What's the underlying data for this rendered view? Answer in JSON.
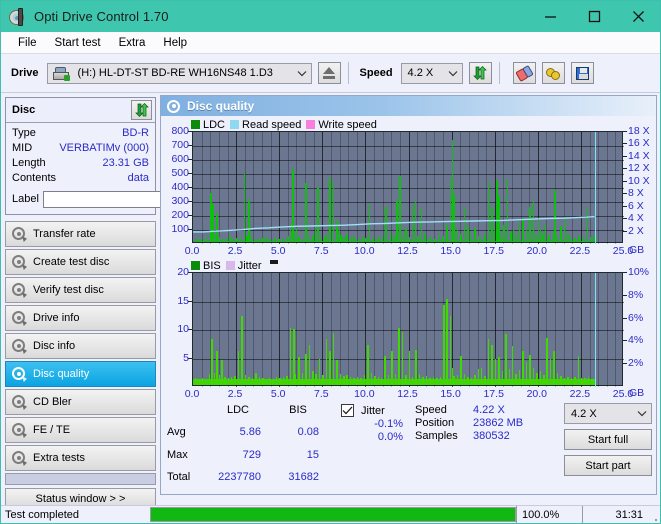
{
  "window": {
    "title": "Opti Drive Control 1.70",
    "icon": "disc-case-icon",
    "minimize": "—",
    "maximize": "□",
    "close": "✕",
    "titlebar_color": "#3ec7ae"
  },
  "menu": {
    "items": [
      {
        "label": "File"
      },
      {
        "label": "Start test"
      },
      {
        "label": "Extra"
      },
      {
        "label": "Help"
      }
    ]
  },
  "toolbar": {
    "drive_label": "Drive",
    "drive_value": "(H:)  HL-DT-ST BD-RE  WH16NS48 1.D3",
    "eject_title": "eject",
    "speed_label": "Speed",
    "speed_value": "4.2 X",
    "refresh_title": "refresh",
    "eraser_title": "erase",
    "gears_title": "settings",
    "save_title": "save"
  },
  "disc": {
    "title": "Disc",
    "refresh_title": "refresh-disc",
    "rows": [
      {
        "key": "Type",
        "value": "BD-R"
      },
      {
        "key": "MID",
        "value": "VERBATIMv (000)"
      },
      {
        "key": "Length",
        "value": "23.31 GB"
      },
      {
        "key": "Contents",
        "value": "data"
      }
    ],
    "label_key": "Label",
    "label_value": "",
    "label_placeholder": ""
  },
  "sidebar": {
    "items": [
      {
        "label": "Transfer rate",
        "active": false
      },
      {
        "label": "Create test disc",
        "active": false
      },
      {
        "label": "Verify test disc",
        "active": false
      },
      {
        "label": "Drive info",
        "active": false
      },
      {
        "label": "Disc info",
        "active": false
      },
      {
        "label": "Disc quality",
        "active": true
      },
      {
        "label": "CD Bler",
        "active": false
      },
      {
        "label": "FE / TE",
        "active": false
      },
      {
        "label": "Extra tests",
        "active": false
      }
    ],
    "status_window_button": "Status window > >"
  },
  "panel": {
    "title": "Disc quality",
    "icon": "disc-quality-icon"
  },
  "chart_data": [
    {
      "type": "bar",
      "name": "ldc-chart",
      "title": "",
      "xlabel": "GB",
      "ylabel": "",
      "xlim": [
        0,
        25
      ],
      "ylim": [
        0,
        800
      ],
      "y2lim": [
        0,
        18
      ],
      "grid": true,
      "legend_position": "top-left",
      "legend": [
        {
          "label": "LDC",
          "color": "#0a8c0a"
        },
        {
          "label": "Read speed",
          "color": "#8fd8f2"
        },
        {
          "label": "Write speed",
          "color": "#f87fe0"
        }
      ],
      "xticks": [
        "0.0",
        "2.5",
        "5.0",
        "7.5",
        "10.0",
        "12.5",
        "15.0",
        "17.5",
        "20.0",
        "22.5",
        "25.0"
      ],
      "yticks": [
        100,
        200,
        300,
        400,
        500,
        600,
        700,
        800
      ],
      "y2ticks": [
        "2 X",
        "4 X",
        "6 X",
        "8 X",
        "10 X",
        "12 X",
        "14 X",
        "16 X",
        "18 X"
      ],
      "series": [
        {
          "name": "LDC",
          "color": "#0fbf0f",
          "x": [
            0.15,
            0.35,
            0.55,
            0.8,
            1.0,
            1.1,
            1.2,
            1.35,
            1.5,
            1.7,
            1.9,
            2.1,
            2.3,
            2.5,
            2.7,
            2.95,
            3.1,
            3.2,
            3.35,
            3.6,
            3.8,
            4.0,
            4.2,
            4.45,
            4.7,
            4.95,
            5.2,
            5.45,
            5.6,
            5.75,
            5.85,
            5.95,
            6.1,
            6.3,
            6.5,
            6.7,
            6.9,
            7.05,
            7.2,
            7.4,
            7.6,
            7.75,
            7.9,
            8.1,
            8.3,
            8.45,
            8.55,
            8.7,
            8.9,
            9.1,
            9.3,
            9.55,
            9.8,
            10.0,
            10.2,
            10.4,
            10.55,
            10.75,
            10.95,
            11.15,
            11.4,
            11.6,
            11.8,
            11.95,
            12.15,
            12.3,
            12.5,
            12.7,
            12.85,
            13.0,
            13.2,
            13.4,
            13.6,
            13.8,
            14.0,
            14.2,
            14.45,
            14.7,
            14.9,
            15.0,
            15.1,
            15.3,
            15.5,
            15.7,
            15.9,
            16.1,
            16.3,
            16.5,
            16.7,
            16.9,
            17.1,
            17.3,
            17.45,
            17.6,
            17.7,
            17.85,
            18.0,
            18.2,
            18.4,
            18.55,
            18.7,
            18.9,
            19.1,
            19.3,
            19.5,
            19.7,
            19.85,
            20.0,
            20.1,
            20.25,
            20.4,
            20.6,
            20.8,
            20.95,
            21.1,
            21.3,
            21.5,
            21.7,
            21.9,
            22.1,
            22.35,
            22.6,
            22.85,
            23.0,
            23.2
          ],
          "values": [
            30,
            20,
            25,
            40,
            350,
            270,
            60,
            210,
            35,
            25,
            30,
            40,
            25,
            30,
            35,
            495,
            40,
            300,
            55,
            25,
            20,
            30,
            35,
            25,
            30,
            25,
            30,
            40,
            130,
            525,
            70,
            100,
            35,
            30,
            420,
            50,
            40,
            100,
            395,
            45,
            35,
            60,
            455,
            420,
            150,
            95,
            50,
            40,
            55,
            35,
            40,
            30,
            35,
            30,
            270,
            30,
            25,
            35,
            40,
            250,
            80,
            45,
            290,
            470,
            60,
            100,
            35,
            260,
            290,
            45,
            240,
            55,
            30,
            40,
            25,
            65,
            45,
            120,
            460,
            730,
            340,
            90,
            60,
            240,
            105,
            55,
            100,
            45,
            35,
            60,
            430,
            250,
            100,
            440,
            330,
            55,
            125,
            460,
            70,
            90,
            60,
            135,
            170,
            95,
            250,
            300,
            60,
            160,
            95,
            60,
            130,
            50,
            70,
            370,
            60,
            115,
            180,
            55,
            35,
            30,
            45,
            40,
            250,
            35,
            40
          ]
        },
        {
          "name": "Read speed",
          "color": "#9fe0f5",
          "type": "line",
          "x": [
            0.0,
            0.6,
            1.3,
            2.0,
            2.8,
            3.6,
            4.4,
            5.2,
            6.0,
            6.9,
            7.8,
            8.6,
            9.4,
            10.3,
            11.1,
            12.0,
            12.9,
            13.8,
            14.6,
            15.5,
            16.3,
            17.1,
            18.0,
            18.9,
            19.8,
            20.6,
            21.5,
            22.3,
            23.0,
            23.3
          ],
          "values": [
            1.95,
            1.95,
            2.05,
            2.15,
            2.3,
            2.5,
            2.6,
            2.75,
            2.85,
            2.9,
            2.95,
            3.0,
            3.1,
            3.25,
            3.3,
            3.4,
            3.5,
            3.55,
            3.6,
            3.65,
            3.7,
            3.75,
            3.8,
            3.9,
            4.0,
            4.1,
            4.15,
            4.25,
            4.35,
            4.4
          ]
        }
      ],
      "end_marker": {
        "x": 23.3,
        "color": "#7fe0f5",
        "label": "read-position-marker"
      }
    },
    {
      "type": "bar",
      "name": "bis-chart",
      "title": "",
      "xlabel": "GB",
      "ylabel": "",
      "xlim": [
        0,
        25
      ],
      "ylim": [
        0,
        20
      ],
      "y2lim": [
        0,
        10
      ],
      "grid": true,
      "legend_position": "top-left",
      "legend": [
        {
          "label": "BIS",
          "color": "#0a8c0a"
        },
        {
          "label": "Jitter",
          "color": "#d8b8e8"
        }
      ],
      "xticks": [
        "0.0",
        "2.5",
        "5.0",
        "7.5",
        "10.0",
        "12.5",
        "15.0",
        "17.5",
        "20.0",
        "22.5",
        "25.0"
      ],
      "yticks": [
        5,
        10,
        15,
        20
      ],
      "y2ticks": [
        "2%",
        "4%",
        "6%",
        "8%",
        "10%"
      ],
      "series": [
        {
          "name": "BIS",
          "color": "#3fd800",
          "x": [
            0.1,
            0.3,
            0.5,
            0.7,
            0.9,
            1.05,
            1.2,
            1.35,
            1.5,
            1.65,
            1.8,
            2.0,
            2.2,
            2.4,
            2.6,
            2.8,
            3.0,
            3.2,
            3.4,
            3.6,
            3.8,
            4.0,
            4.2,
            4.4,
            4.6,
            4.8,
            5.0,
            5.2,
            5.4,
            5.6,
            5.8,
            5.9,
            6.1,
            6.3,
            6.5,
            6.7,
            6.9,
            7.1,
            7.3,
            7.5,
            7.7,
            7.9,
            8.1,
            8.3,
            8.5,
            8.7,
            8.9,
            9.1,
            9.3,
            9.5,
            9.7,
            9.9,
            10.1,
            10.3,
            10.5,
            10.7,
            10.9,
            11.1,
            11.3,
            11.5,
            11.7,
            11.9,
            12.1,
            12.3,
            12.5,
            12.7,
            12.9,
            13.1,
            13.3,
            13.5,
            13.7,
            13.9,
            14.1,
            14.3,
            14.5,
            14.7,
            14.9,
            15.0,
            15.1,
            15.3,
            15.5,
            15.7,
            15.9,
            16.1,
            16.3,
            16.5,
            16.7,
            16.9,
            17.1,
            17.3,
            17.5,
            17.7,
            17.9,
            18.1,
            18.3,
            18.5,
            18.7,
            18.9,
            19.1,
            19.3,
            19.5,
            19.7,
            19.9,
            20.1,
            20.3,
            20.5,
            20.7,
            20.9,
            21.1,
            21.3,
            21.5,
            21.7,
            21.9,
            22.1,
            22.3,
            22.5,
            22.7,
            22.9,
            23.1,
            23.25
          ],
          "values": [
            1.2,
            1.0,
            1.3,
            1.1,
            2.0,
            8.1,
            2.2,
            5.9,
            1.8,
            4.4,
            1.5,
            1.2,
            1.4,
            1.6,
            5.9,
            12.2,
            1.8,
            1.5,
            1.2,
            2.1,
            1.4,
            1.2,
            1.0,
            1.3,
            1.1,
            1.5,
            1.2,
            1.4,
            1.6,
            10.0,
            9.9,
            2.0,
            4.9,
            2.2,
            5.5,
            7.0,
            2.4,
            1.9,
            4.5,
            1.7,
            8.1,
            6.0,
            9.2,
            4.4,
            2.0,
            1.6,
            1.8,
            1.4,
            1.2,
            1.5,
            1.3,
            1.7,
            7.0,
            2.2,
            1.6,
            1.4,
            1.2,
            5.1,
            1.8,
            5.9,
            2.0,
            10.0,
            9.3,
            1.7,
            5.9,
            1.5,
            6.1,
            2.0,
            1.4,
            1.6,
            1.3,
            1.5,
            1.2,
            1.4,
            14.1,
            15.1,
            12.1,
            3.0,
            1.6,
            1.8,
            5.1,
            2.0,
            1.5,
            1.3,
            1.7,
            2.8,
            3.0,
            1.6,
            8.0,
            7.1,
            4.6,
            5.0,
            2.5,
            9.0,
            2.9,
            6.9,
            1.9,
            2.6,
            6.0,
            4.0,
            5.2,
            3.0,
            2.1,
            2.4,
            1.8,
            8.2,
            4.5,
            6.0,
            2.2,
            1.6,
            1.3,
            1.5,
            1.2,
            1.4,
            5.1,
            1.3,
            1.2,
            1.5,
            1.1,
            1.0
          ]
        }
      ],
      "end_marker": {
        "x": 23.3,
        "color": "#7fe0f5",
        "label": "read-position-marker"
      }
    }
  ],
  "stats": {
    "col_headers": [
      "LDC",
      "BIS"
    ],
    "rows": [
      {
        "label": "Avg",
        "ldc": "5.86",
        "bis": "0.08",
        "jitter": "-0.1%"
      },
      {
        "label": "Max",
        "ldc": "729",
        "bis": "15",
        "jitter": "0.0%"
      },
      {
        "label": "Total",
        "ldc": "2237780",
        "bis": "31682",
        "jitter": ""
      }
    ],
    "jitter_label": "Jitter",
    "jitter_checked": true,
    "speed_label": "Speed",
    "speed_value": "4.22 X",
    "position_label": "Position",
    "position_value": "23862 MB",
    "samples_label": "Samples",
    "samples_value": "380532",
    "speed_select": "4.2 X",
    "start_full": "Start full",
    "start_part": "Start part"
  },
  "statusbar": {
    "text": "Test completed",
    "progress_percent": 100,
    "progress_text": "100.0%",
    "elapsed": "31:31",
    "progress_color": "#12b812"
  }
}
